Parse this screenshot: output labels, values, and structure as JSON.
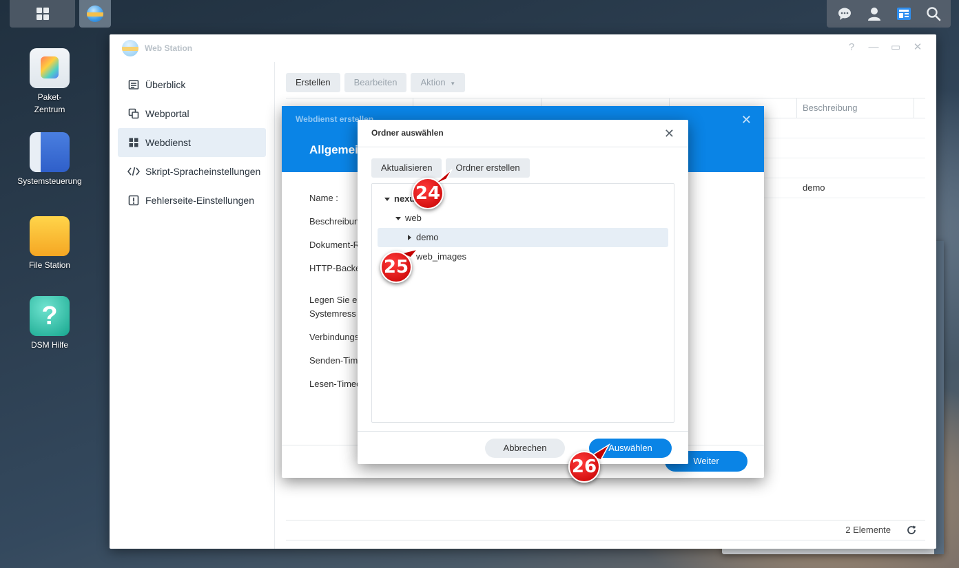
{
  "taskbar": {
    "left_items": [
      {
        "icon": "grid-icon"
      },
      {
        "icon": "web-station-icon"
      }
    ],
    "right_icons": [
      "chat-icon",
      "user-icon",
      "widgets-icon",
      "search-icon"
    ]
  },
  "desktop": {
    "icons": [
      {
        "label": "Paket-\nZentrum",
        "icon": "package-center-icon"
      },
      {
        "label": "Systemsteuerung",
        "icon": "control-panel-icon"
      },
      {
        "label": "File Station",
        "icon": "folder-icon"
      },
      {
        "label": "DSM Hilfe",
        "icon": "help-icon",
        "glyph": "?"
      }
    ]
  },
  "window": {
    "title": "Web Station",
    "controls": [
      "?",
      "—",
      "▭",
      "✕"
    ],
    "sidebar": [
      {
        "label": "Überblick",
        "icon": "overview-icon",
        "active": false
      },
      {
        "label": "Webportal",
        "icon": "portal-icon",
        "active": false
      },
      {
        "label": "Webdienst",
        "icon": "service-icon",
        "active": true
      },
      {
        "label": "Skript-Spracheinstellungen",
        "icon": "code-icon",
        "active": false
      },
      {
        "label": "Fehlerseite-Einstellungen",
        "icon": "error-page-icon",
        "active": false
      }
    ],
    "toolbar": {
      "create": "Erstellen",
      "edit": "Bearbeiten",
      "action": "Aktion"
    },
    "table": {
      "visible_header": "Beschreibung",
      "rows": [
        {
          "description": ""
        },
        {
          "description": ""
        },
        {
          "description": ""
        },
        {
          "description": "demo"
        }
      ]
    },
    "footer": {
      "count": "2 Elemente"
    }
  },
  "wizard": {
    "title": "Webdienst erstellen",
    "heading": "Allgemein",
    "fields": [
      "Name :",
      "Beschreibun",
      "Dokument-R",
      "HTTP-Backe",
      "Legen Sie e\nSystemress",
      "Verbindungs",
      "Senden-Tim",
      "Lesen-Timeo"
    ],
    "next_button": "Weiter"
  },
  "folder_dialog": {
    "title": "Ordner auswählen",
    "refresh_button": "Aktualisieren",
    "create_folder_button": "Ordner erstellen",
    "tree": [
      {
        "label": "nexu",
        "level": 0,
        "expanded": true,
        "selected": false,
        "bold": true
      },
      {
        "label": "web",
        "level": 1,
        "expanded": true,
        "selected": false,
        "bold": false
      },
      {
        "label": "demo",
        "level": 2,
        "expanded": false,
        "selected": true,
        "bold": false
      },
      {
        "label": "web_images",
        "level": 2,
        "expanded": false,
        "selected": false,
        "bold": false
      }
    ],
    "cancel_button": "Abbrechen",
    "select_button": "Auswählen"
  },
  "markers": [
    "24",
    "25",
    "26"
  ],
  "colors": {
    "accent": "#0a84e6",
    "marker": "#d40000",
    "selected_row": "#e6eef6"
  }
}
